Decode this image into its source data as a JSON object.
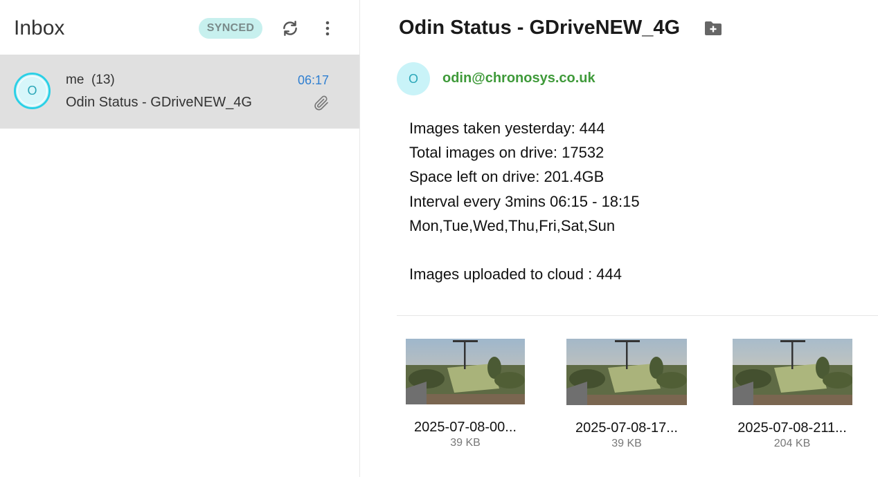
{
  "left": {
    "title": "Inbox",
    "badge": "SYNCED",
    "refresh_icon": "refresh-icon",
    "more_icon": "more-vertical-icon"
  },
  "mail_row": {
    "avatar_initial": "O",
    "sender": "me",
    "count": "(13)",
    "time": "06:17",
    "subject": "Odin Status - GDriveNEW_4G",
    "attachment_icon": "paperclip-icon"
  },
  "message": {
    "subject": "Odin Status - GDriveNEW_4G",
    "folder_icon": "folder-plus-icon",
    "from_initial": "O",
    "from_email": "odin@chronosys.co.uk",
    "body_lines": [
      "Images taken yesterday: 444",
      "Total images on drive: 17532",
      "Space left on drive: 201.4GB",
      "Interval every 3mins 06:15 - 18:15",
      "Mon,Tue,Wed,Thu,Fri,Sat,Sun",
      "",
      "Images uploaded to cloud : 444"
    ],
    "attachments": [
      {
        "name": "2025-07-08-00...",
        "size": "39 KB"
      },
      {
        "name": "2025-07-08-17...",
        "size": "39 KB"
      },
      {
        "name": "2025-07-08-211...",
        "size": "204 KB"
      }
    ]
  },
  "colors": {
    "accent_cyan": "#2bd0e6",
    "badge_bg": "#c7f0ee",
    "time_blue": "#2f7fd1",
    "email_green": "#3f9a3a",
    "selected_row": "#e0e0e0"
  }
}
